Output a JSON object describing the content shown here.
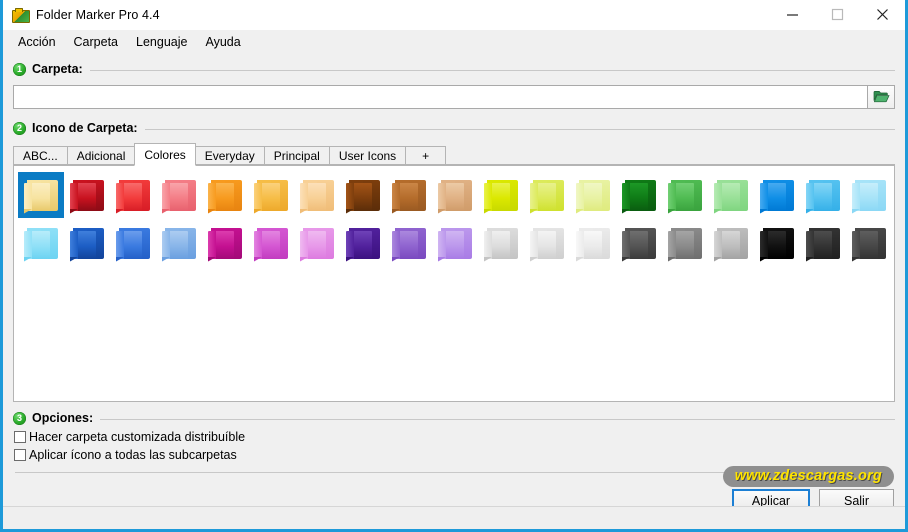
{
  "window": {
    "title": "Folder Marker Pro 4.4",
    "app_icon": "folder-marker-logo-icon",
    "controls": {
      "minimize": "minimize-icon",
      "maximize": "maximize-icon",
      "close": "close-icon"
    },
    "frame_color": "#1e9ad9"
  },
  "menubar": {
    "items": [
      {
        "label": "Acción"
      },
      {
        "label": "Carpeta"
      },
      {
        "label": "Lenguaje"
      },
      {
        "label": "Ayuda"
      }
    ]
  },
  "sections": {
    "folder": {
      "badge": "1",
      "label": "Carpeta:",
      "input_value": "",
      "input_placeholder": "",
      "browse_icon": "open-folder-browse-icon"
    },
    "icon": {
      "badge": "2",
      "label": "Icono de Carpeta:"
    },
    "options": {
      "badge": "3",
      "label": "Opciones:",
      "checkboxes": [
        {
          "label": "Hacer carpeta customizada distribuíble",
          "checked": false
        },
        {
          "label": "Aplicar ícono a todas las subcarpetas",
          "checked": false
        }
      ]
    }
  },
  "tabs": {
    "selected": "Colores",
    "items": [
      {
        "label": "ABC..."
      },
      {
        "label": "Adicional"
      },
      {
        "label": "Colores"
      },
      {
        "label": "Everyday"
      },
      {
        "label": "Principal"
      },
      {
        "label": "User Icons"
      },
      {
        "label": "+"
      }
    ]
  },
  "icon_grid": {
    "selected_index": 0,
    "columns": 19,
    "folders": [
      {
        "name": "yellow",
        "dark": "#e8c96a",
        "mid": "#f7e3a0",
        "light": "#fbeec2"
      },
      {
        "name": "dark-red",
        "dark": "#8d0b16",
        "mid": "#c8121f",
        "light": "#e24250"
      },
      {
        "name": "red",
        "dark": "#d81d26",
        "mid": "#f23b3b",
        "light": "#f86a6a"
      },
      {
        "name": "salmon",
        "dark": "#e8616e",
        "mid": "#f47d86",
        "light": "#f9a4aa"
      },
      {
        "name": "orange",
        "dark": "#e88410",
        "mid": "#f79a1e",
        "light": "#fbb44c"
      },
      {
        "name": "light-orange",
        "dark": "#eda92b",
        "mid": "#f6bd46",
        "light": "#fbd17c"
      },
      {
        "name": "peach",
        "dark": "#f0bd78",
        "mid": "#f8d095",
        "light": "#fce0b8"
      },
      {
        "name": "dark-brown",
        "dark": "#5b2d09",
        "mid": "#7d3e0d",
        "light": "#a35417"
      },
      {
        "name": "brown",
        "dark": "#9a5a22",
        "mid": "#b46c2b",
        "light": "#cb8646"
      },
      {
        "name": "tan",
        "dark": "#d09c6a",
        "mid": "#e0b184",
        "light": "#eccaa5"
      },
      {
        "name": "yellow-green",
        "dark": "#c8d900",
        "mid": "#dbe800",
        "light": "#e9f24a"
      },
      {
        "name": "lime",
        "dark": "#cfe12e",
        "mid": "#dcea5a",
        "light": "#e8f18c"
      },
      {
        "name": "pale-lime",
        "dark": "#dfeb7e",
        "mid": "#e8f2a2",
        "light": "#f0f7c4"
      },
      {
        "name": "dark-green",
        "dark": "#0a5c10",
        "mid": "#0f7a16",
        "light": "#1c9826"
      },
      {
        "name": "green",
        "dark": "#3aa33e",
        "mid": "#4fbb52",
        "light": "#72d074"
      },
      {
        "name": "light-green",
        "dark": "#7fd580",
        "mid": "#98e097",
        "light": "#b6ebb4"
      },
      {
        "name": "blue",
        "dark": "#0079d4",
        "mid": "#0f8ee6",
        "light": "#46aaf0"
      },
      {
        "name": "sky-blue",
        "dark": "#35b0e8",
        "mid": "#55c2f0",
        "light": "#85d6f6"
      },
      {
        "name": "pale-blue",
        "dark": "#8bd8f5",
        "mid": "#a6e3f8",
        "light": "#c6eefb"
      },
      {
        "name": "light-cyan",
        "dark": "#6cd3f2",
        "mid": "#8fe0f7",
        "light": "#b7ecfa"
      },
      {
        "name": "royal-blue",
        "dark": "#12449b",
        "mid": "#1c5dc4",
        "light": "#3f7fdc"
      },
      {
        "name": "medium-blue",
        "dark": "#2460c8",
        "mid": "#3a7ae0",
        "light": "#6b9dec"
      },
      {
        "name": "cornflower",
        "dark": "#6a9fe0",
        "mid": "#88b5e9",
        "light": "#acccf1"
      },
      {
        "name": "magenta",
        "dark": "#a30a78",
        "mid": "#c41091",
        "light": "#dc3cae"
      },
      {
        "name": "orchid",
        "dark": "#c23cc0",
        "mid": "#d456d2",
        "light": "#e384e0"
      },
      {
        "name": "pink-violet",
        "dark": "#dd7be0",
        "mid": "#e798e9",
        "light": "#efb9f0"
      },
      {
        "name": "dark-purple",
        "dark": "#3b1180",
        "mid": "#51219c",
        "light": "#6f42b8"
      },
      {
        "name": "purple",
        "dark": "#7a4ac0",
        "mid": "#8f63cf",
        "light": "#ab88de"
      },
      {
        "name": "light-purple",
        "dark": "#a97ce6",
        "mid": "#bb97ec",
        "light": "#d0b5f2"
      },
      {
        "name": "light-gray-1",
        "dark": "#c4c4c4",
        "mid": "#dcdcdc",
        "light": "#efefef"
      },
      {
        "name": "light-gray-2",
        "dark": "#cfcfcf",
        "mid": "#e4e4e4",
        "light": "#f4f4f4"
      },
      {
        "name": "light-gray-3",
        "dark": "#dadada",
        "mid": "#ebebeb",
        "light": "#f8f8f8"
      },
      {
        "name": "dark-gray",
        "dark": "#3b3b3b",
        "mid": "#545454",
        "light": "#6f6f6f"
      },
      {
        "name": "gray",
        "dark": "#6f6f6f",
        "mid": "#8a8a8a",
        "light": "#a5a5a5"
      },
      {
        "name": "silver",
        "dark": "#a3a3a3",
        "mid": "#bdbdbd",
        "light": "#d6d6d6"
      },
      {
        "name": "black",
        "dark": "#000000",
        "mid": "#111111",
        "light": "#2b2b2b"
      },
      {
        "name": "charcoal",
        "dark": "#202020",
        "mid": "#333333",
        "light": "#4d4d4d"
      },
      {
        "name": "slate",
        "dark": "#333333",
        "mid": "#474747",
        "light": "#5e5e5e"
      }
    ]
  },
  "footer": {
    "watermark": "www.zdescargas.org",
    "apply_button": "Aplicar",
    "exit_button": "Salir",
    "apply_focus_color": "#1c7fd4",
    "watermark_text_color": "#ffe400",
    "watermark_bg_color": "#8f8f8f"
  }
}
